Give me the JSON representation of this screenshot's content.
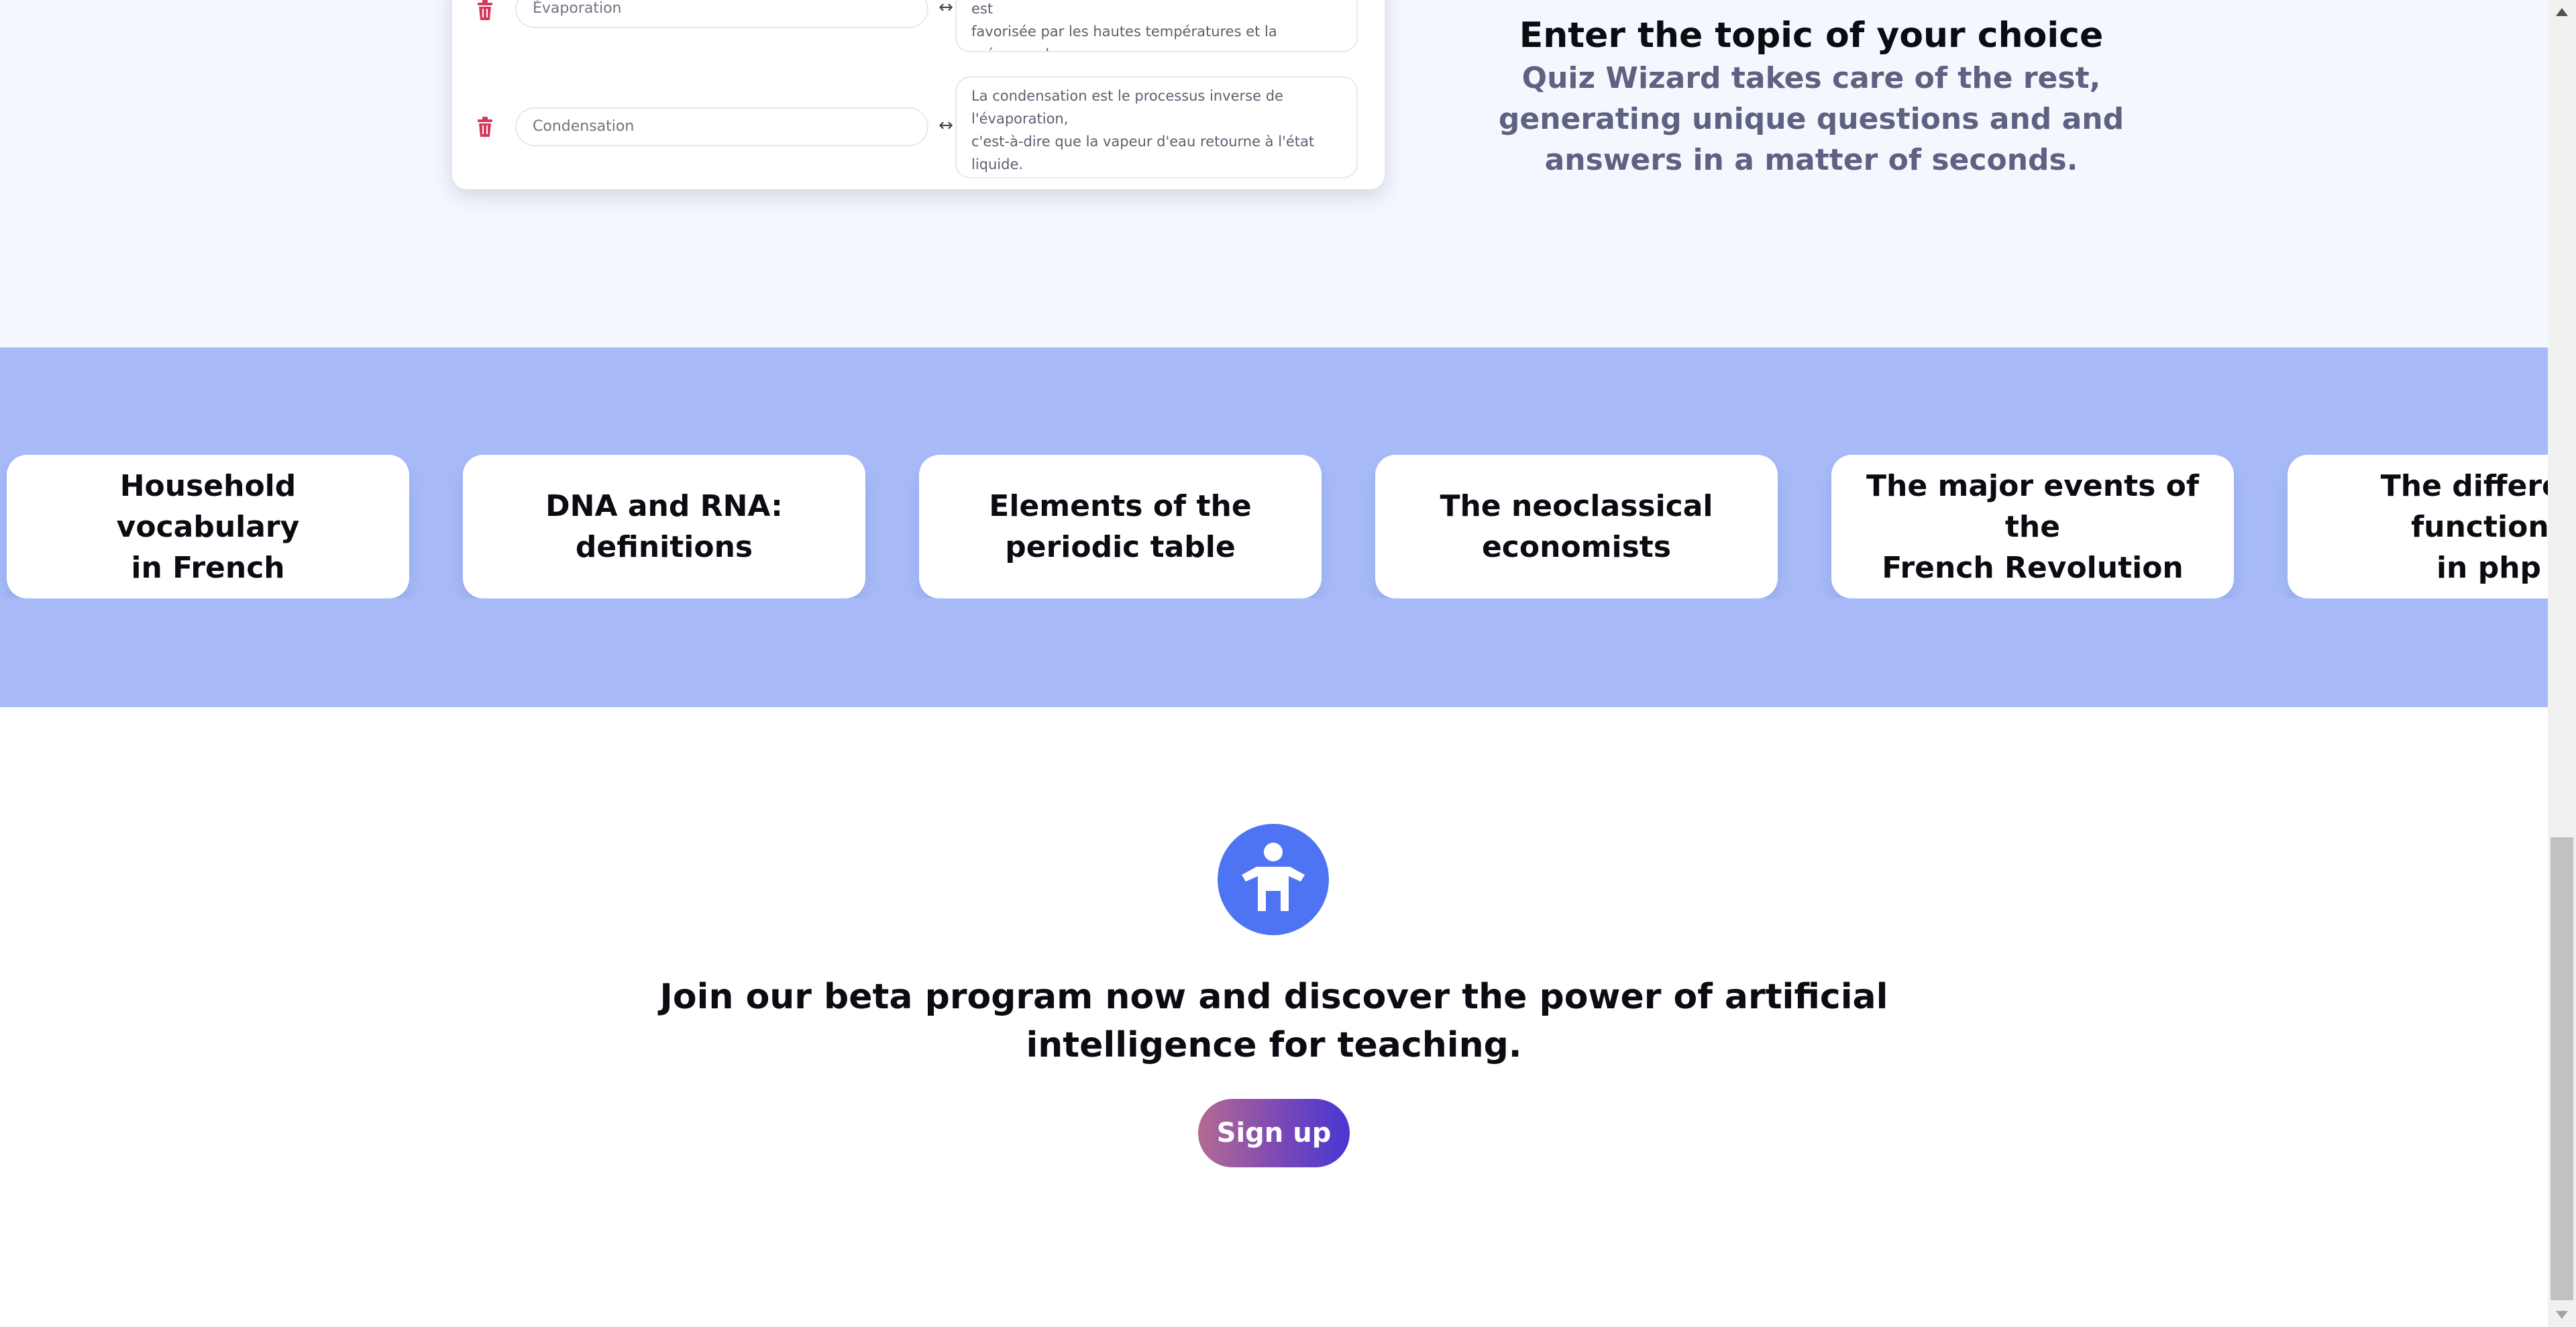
{
  "editor": {
    "rows": [
      {
        "term": "Évaporation",
        "definition": "liquide se transforme en vapeur dans la nature. Elle est\nfavorisée par les hautes températures et la présence du\nsoleil."
      },
      {
        "term": "Condensation",
        "definition": "La condensation est le processus inverse de l'évaporation,\nc'est-à-dire que la vapeur d'eau retourne à l'état liquide.\nElle se produit généralement grâce au refroidissement des\nmasses d'air."
      }
    ],
    "swap_symbol": "↔"
  },
  "feature": {
    "title": "Enter the topic of your choice",
    "description": "Quiz Wizard takes care of the rest, generating unique questions and and answers in a matter of seconds."
  },
  "topics": [
    "Household vocabulary\nin French",
    "DNA and RNA:\ndefinitions",
    "Elements of the\nperiodic table",
    "The neoclassical\neconomists",
    "The major events of the\nFrench Revolution",
    "The different functions\nin php"
  ],
  "cta": {
    "title": "Join our beta program now and discover the power of artificial intelligence for teaching.",
    "button_label": "Sign up"
  },
  "colors": {
    "topics_band": "#a8bbf8",
    "accent_blue": "#4e73f3",
    "trash_red": "#d63a5a"
  },
  "icons": {
    "delete": "trash-icon",
    "swap": "swap-arrows-icon",
    "cta": "person-accessibility-icon"
  }
}
